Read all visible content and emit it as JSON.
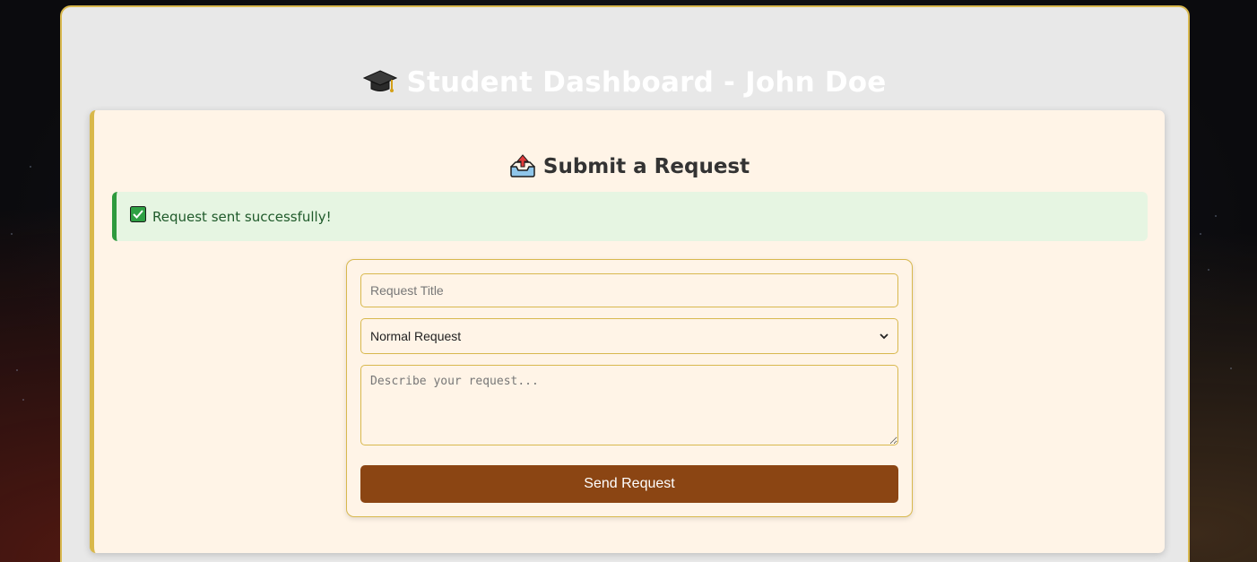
{
  "header": {
    "title": "Student Dashboard - John Doe",
    "icon": "graduation-cap-icon"
  },
  "request_card": {
    "title": "Submit a Request",
    "icon": "outbox-tray-icon"
  },
  "alert": {
    "icon": "check-mark-icon",
    "message": "Request sent successfully!",
    "color": "#2e9a3e"
  },
  "form": {
    "title_placeholder": "Request Title",
    "type_options": [
      "Normal Request"
    ],
    "type_selected": "Normal Request",
    "description_placeholder": "Describe your request...",
    "submit_label": "Send Request"
  },
  "colors": {
    "accent_border": "#d8b84e",
    "button": "#8b4513",
    "card_background": "#fff4e7"
  }
}
